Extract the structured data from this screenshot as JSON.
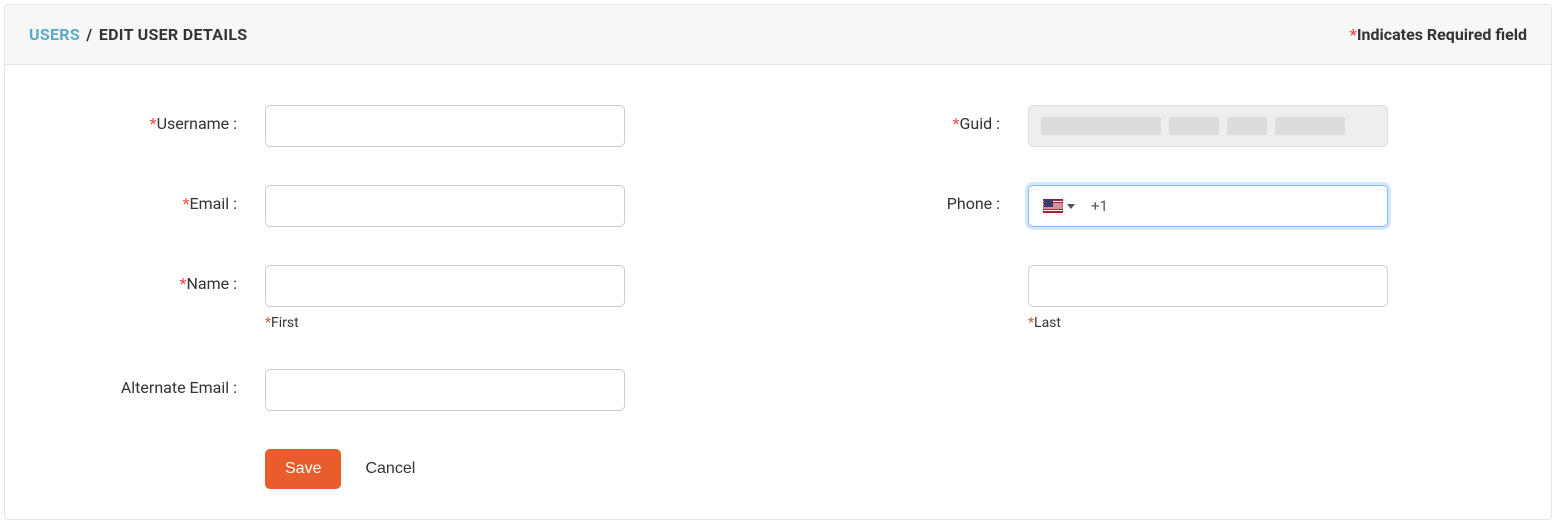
{
  "header": {
    "breadcrumb_root": "USERS",
    "breadcrumb_sep": "/",
    "breadcrumb_current": "EDIT USER DETAILS",
    "required_note": "Indicates Required field"
  },
  "labels": {
    "username": "Username :",
    "email": "Email :",
    "name": "Name :",
    "alternate_email": "Alternate Email :",
    "guid": "Guid :",
    "phone": "Phone :",
    "first": "First",
    "last": "Last"
  },
  "values": {
    "username": "",
    "email": "",
    "first_name": "",
    "last_name": "",
    "alternate_email": "",
    "phone_prefix": "+1",
    "phone": ""
  },
  "buttons": {
    "save": "Save",
    "cancel": "Cancel"
  }
}
